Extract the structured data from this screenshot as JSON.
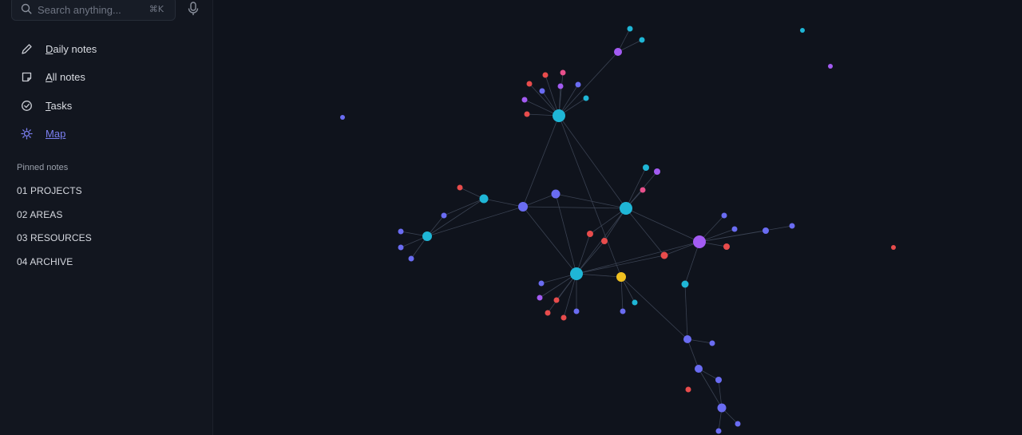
{
  "search": {
    "placeholder": "Search anything...",
    "shortcut": "⌘K"
  },
  "nav": [
    {
      "label": "Daily notes",
      "icon": "pencil-icon",
      "active": false
    },
    {
      "label": "All notes",
      "icon": "note-icon",
      "active": false
    },
    {
      "label": "Tasks",
      "icon": "check-circle-icon",
      "active": false
    },
    {
      "label": "Map",
      "icon": "map-icon",
      "active": true
    }
  ],
  "pinned": {
    "heading": "Pinned notes",
    "items": [
      "01 PROJECTS",
      "02 AREAS",
      "03 RESOURCES",
      "04 ARCHIVE"
    ]
  },
  "colors": {
    "accent": "#7b7ff0",
    "node_cyan": "#1fb6d6",
    "node_indigo": "#6a6cf2",
    "node_purple": "#a35bf2",
    "node_red": "#e84c4c",
    "node_pink": "#e8508c",
    "node_yellow": "#f0c020",
    "edge": "#3a4252"
  }
}
